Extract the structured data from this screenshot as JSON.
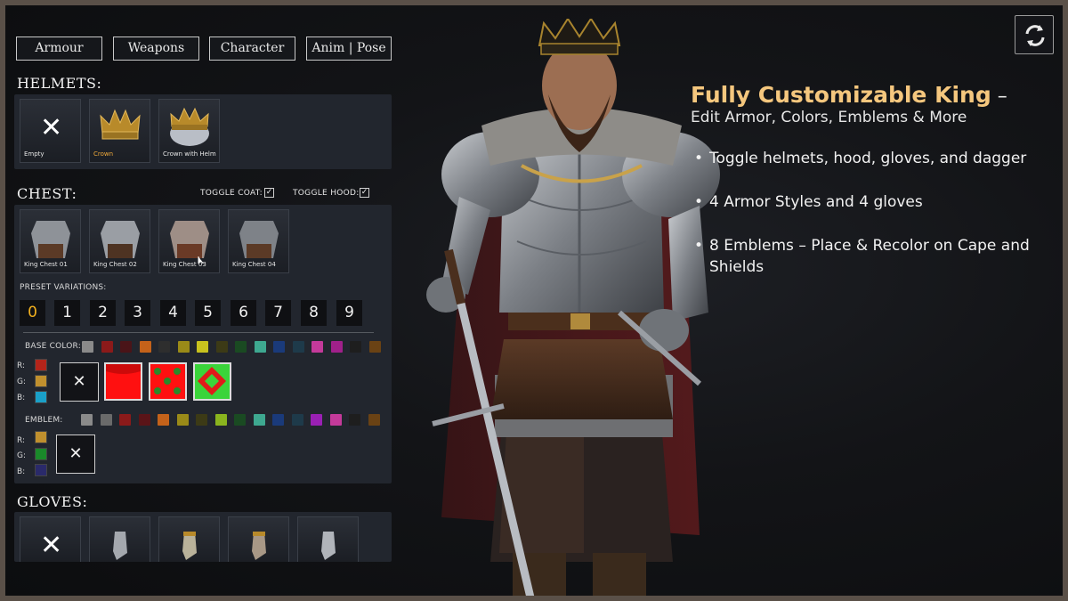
{
  "tabs": [
    "Armour",
    "Weapons",
    "Character",
    "Anim | Pose"
  ],
  "helmets": {
    "title": "HELMETS:",
    "items": [
      {
        "label": "Empty",
        "icon": "x-icon",
        "selected": false
      },
      {
        "label": "Crown",
        "icon": "crown-icon",
        "selected": true
      },
      {
        "label": "Crown with Helm",
        "icon": "crown-helm-icon",
        "selected": false
      }
    ]
  },
  "chest": {
    "title": "CHEST:",
    "toggle_coat": "TOGGLE COAT:",
    "toggle_hood": "TOGGLE HOOD:",
    "check_mark": "✓",
    "items": [
      "King Chest 01",
      "King Chest 02",
      "King Chest 03",
      "King Chest 04"
    ],
    "preset_label": "PRESET VARIATIONS:",
    "presets": [
      "0",
      "1",
      "2",
      "3",
      "4",
      "5",
      "6",
      "7",
      "8",
      "9"
    ],
    "active_preset": "0",
    "base_color_label": "BASE COLOR:",
    "base_colors": [
      "#8a8a8a",
      "#8b1a1a",
      "#4a1418",
      "#c4621a",
      "#2e2e2e",
      "#9a8a18",
      "#c8c21e",
      "#3c3a16",
      "#1a4a22",
      "#3ea890",
      "#1a3a7a",
      "#1e3a4a",
      "#c43a9a",
      "#a0208a",
      "#1e1e1e",
      "#6a4214"
    ],
    "base_rgb": {
      "r_label": "R:",
      "g_label": "G:",
      "b_label": "B:",
      "r": "#b3241a",
      "g": "#c0902e",
      "b": "#1aa0c8"
    },
    "emblem_label": "EMBLEM:",
    "emblem_colors": [
      "#8a8a8a",
      "#6a6a6a",
      "#8b1a1a",
      "#5a1418",
      "#c4621a",
      "#9a8a18",
      "#3c3a16",
      "#8ab41e",
      "#1a4a22",
      "#3ea890",
      "#1a3a7a",
      "#1e3a4a",
      "#9a20b4",
      "#c43a9a",
      "#1e1e1e",
      "#6a4214"
    ],
    "emblem_rgb": {
      "r_label": "R:",
      "g_label": "G:",
      "b_label": "B:",
      "r": "#c0902e",
      "g": "#1a8a2a",
      "b": "#2a2a6a"
    },
    "x_glyph": "✕"
  },
  "gloves": {
    "title": "GLOVES:",
    "items": [
      "empty",
      "glove-1",
      "glove-2",
      "glove-3",
      "glove-4"
    ]
  },
  "hero": {
    "title": "Fully Customizable King",
    "dash": " –",
    "subtitle": "Edit Armor, Colors, Emblems & More",
    "bullets": [
      "Toggle helmets, hood, gloves, and dagger",
      "4 Armor Styles and 4 gloves",
      "8 Emblems – Place & Recolor on Cape and Shields"
    ]
  },
  "colors": {
    "accent_gold": "#f5c77e",
    "active_orange": "#f2b01e",
    "panel_bg": "#22262e"
  }
}
